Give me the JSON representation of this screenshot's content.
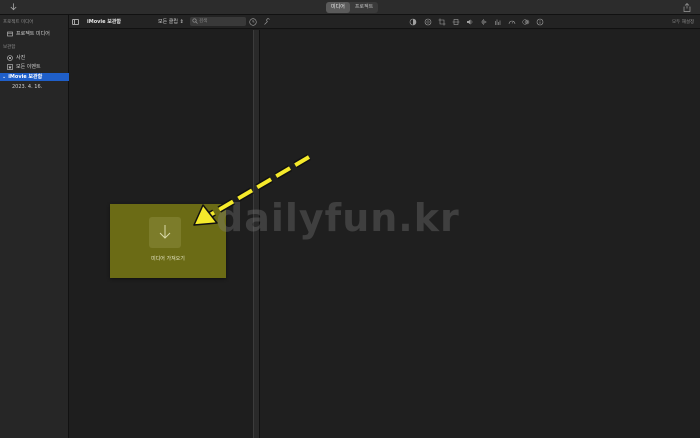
{
  "toolbar": {
    "tabs": [
      {
        "label": "미디어",
        "active": true
      },
      {
        "label": "프로젝트",
        "active": false
      }
    ]
  },
  "sidebar": {
    "section_project_media": "프로젝트 미디어",
    "project_media_item": "프로젝트 미디어",
    "section_libraries": "보관함",
    "items": [
      {
        "label": "사진",
        "icon": "photos-icon"
      },
      {
        "label": "모든 이벤트",
        "icon": "star-icon"
      }
    ],
    "library": {
      "label": "iMovie 보관함",
      "selected": true
    },
    "event": {
      "label": "2023. 4. 16."
    }
  },
  "browser": {
    "title": "iMovie 보관함",
    "filter": "모든 클립",
    "search_placeholder": "검색"
  },
  "viewer": {
    "reset_all": "모두 재설정"
  },
  "import": {
    "label": "미디어 가져오기"
  },
  "overlay": {
    "watermark": "dailyfun.kr",
    "arrow_color": "#f5ea2b"
  },
  "colors": {
    "selection": "#1f5fc9",
    "import_card": "#6b6b15"
  }
}
